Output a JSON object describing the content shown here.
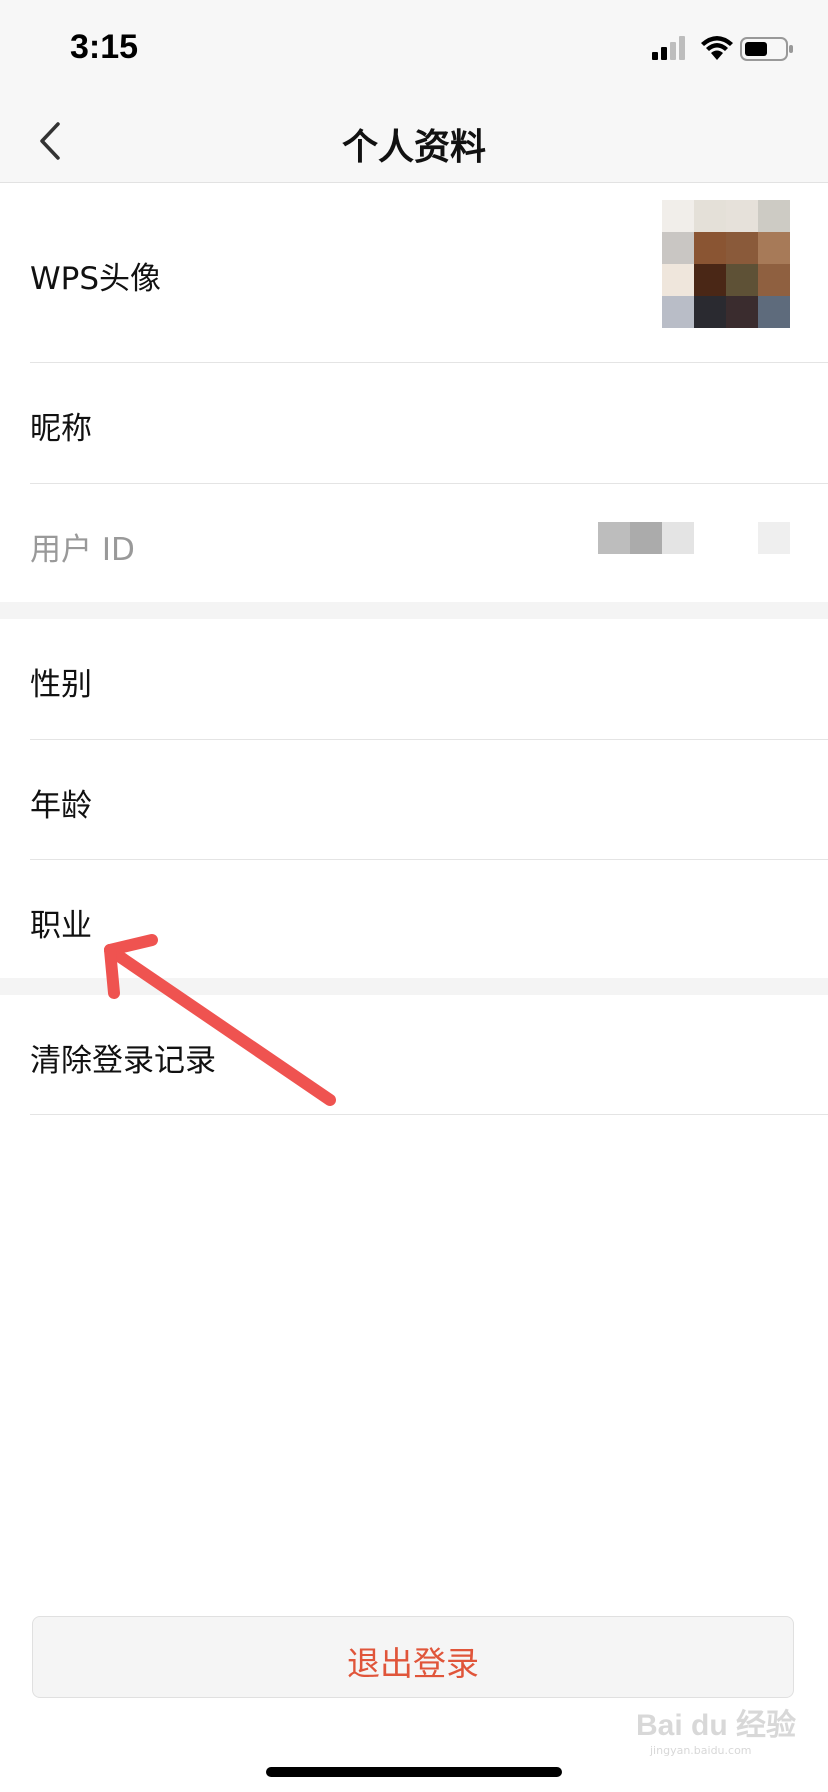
{
  "status_bar": {
    "time": "3:15"
  },
  "nav": {
    "title": "个人资料",
    "back_icon": "chevron-left-icon"
  },
  "rows": {
    "avatar_label": "WPS头像",
    "nickname_label": "昵称",
    "user_id_label": "用户 ID",
    "gender_label": "性别",
    "age_label": "年龄",
    "occupation_label": "职业",
    "clear_login_label": "清除登录记录"
  },
  "logout": {
    "label": "退出登录",
    "color": "#e0553a"
  },
  "watermark": {
    "text": "Bai du 经验",
    "subtext": "jingyan.baidu.com"
  },
  "colors": {
    "annotation_arrow": "#ef5350",
    "section_gap": "#f4f4f4"
  }
}
